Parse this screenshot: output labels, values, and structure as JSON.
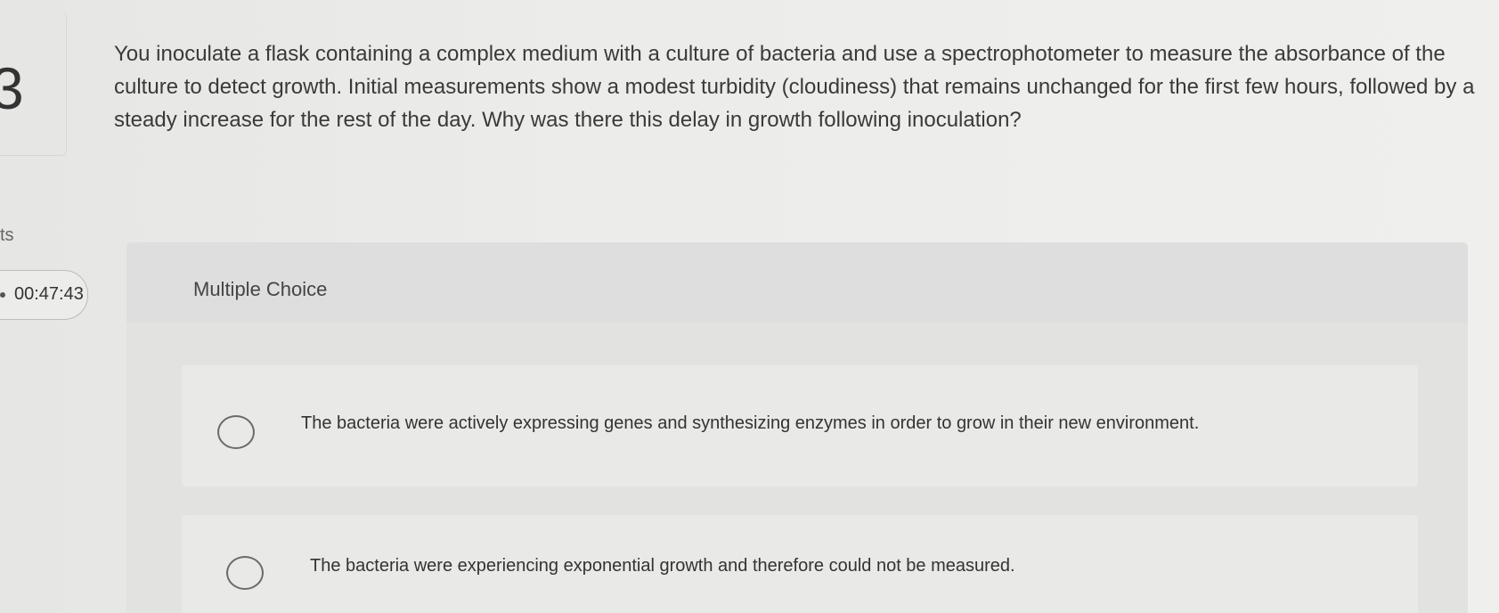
{
  "question": {
    "number": "3",
    "text": "You inoculate a flask containing a complex medium with a culture of bacteria and use a spectrophotometer to measure the absorbance of the culture to detect growth. Initial measurements show a modest turbidity (cloudiness) that remains unchanged for the first few hours, followed by a steady increase for the rest of the day. Why was there this delay in growth following inoculation?"
  },
  "sidebar": {
    "partial_label": "ts",
    "timer": "00:47:43"
  },
  "multiple_choice": {
    "label": "Multiple Choice",
    "options": [
      {
        "text": "The bacteria were actively expressing genes and synthesizing enzymes in order to grow in their new environment."
      },
      {
        "text": "The bacteria were experiencing exponential growth and therefore could not be measured."
      }
    ]
  },
  "colors": {
    "background": "#ececea",
    "panel": "#e2e2e0",
    "text": "#3a3a3a",
    "radio_border": "#6a6a6a"
  }
}
